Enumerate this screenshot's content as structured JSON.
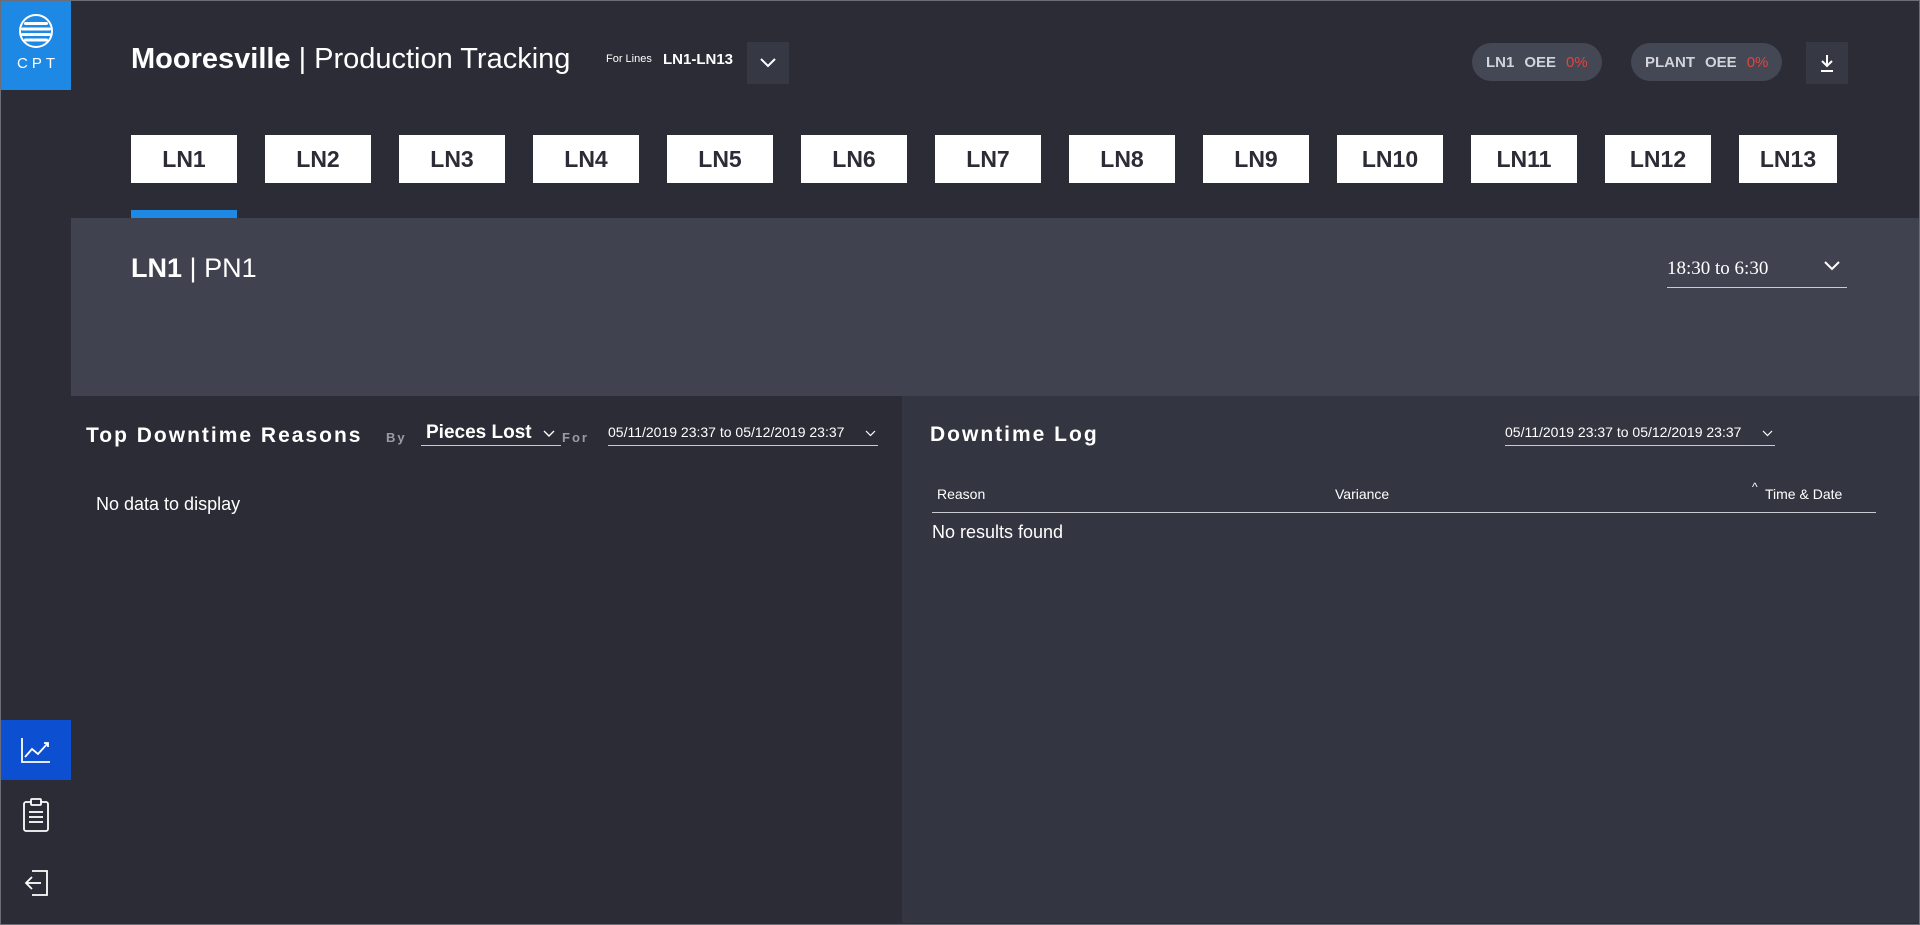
{
  "logo": {
    "text": "CPT"
  },
  "header": {
    "site": "Mooresville",
    "separator": "|",
    "title": "Production Tracking",
    "for_lines_label": "For Lines",
    "lines_value": "LN1-LN13",
    "oee_pills": [
      {
        "name": "LN1",
        "label": "OEE",
        "value": "0%"
      },
      {
        "name": "PLANT",
        "label": "OEE",
        "value": "0%"
      }
    ]
  },
  "tabs": [
    "LN1",
    "LN2",
    "LN3",
    "LN4",
    "LN5",
    "LN6",
    "LN7",
    "LN8",
    "LN9",
    "LN10",
    "LN11",
    "LN12",
    "LN13"
  ],
  "active_tab": "LN1",
  "line_section": {
    "line": "LN1",
    "separator": "|",
    "part": "PN1",
    "shift": "18:30 to 6:30"
  },
  "top_downtime": {
    "title": "Top Downtime Reasons",
    "by_label": "By",
    "by_value": "Pieces Lost",
    "for_label": "For",
    "range": "05/11/2019 23:37 to 05/12/2019 23:37",
    "empty_message": "No data to display"
  },
  "downtime_log": {
    "title": "Downtime Log",
    "range": "05/11/2019 23:37 to 05/12/2019 23:37",
    "columns": [
      "Reason",
      "Variance",
      "Time & Date"
    ],
    "sort_indicator": "^",
    "empty_message": "No results found"
  },
  "sidebar": {
    "items": [
      {
        "icon": "chart-line-icon",
        "active": true
      },
      {
        "icon": "clipboard-icon",
        "active": false
      },
      {
        "icon": "logout-icon",
        "active": false
      }
    ]
  },
  "colors": {
    "accent": "#1e88e5",
    "active_nav": "#0d4fd1",
    "background": "#2b2c35",
    "band": "#41424f",
    "alert": "#e0453f"
  }
}
